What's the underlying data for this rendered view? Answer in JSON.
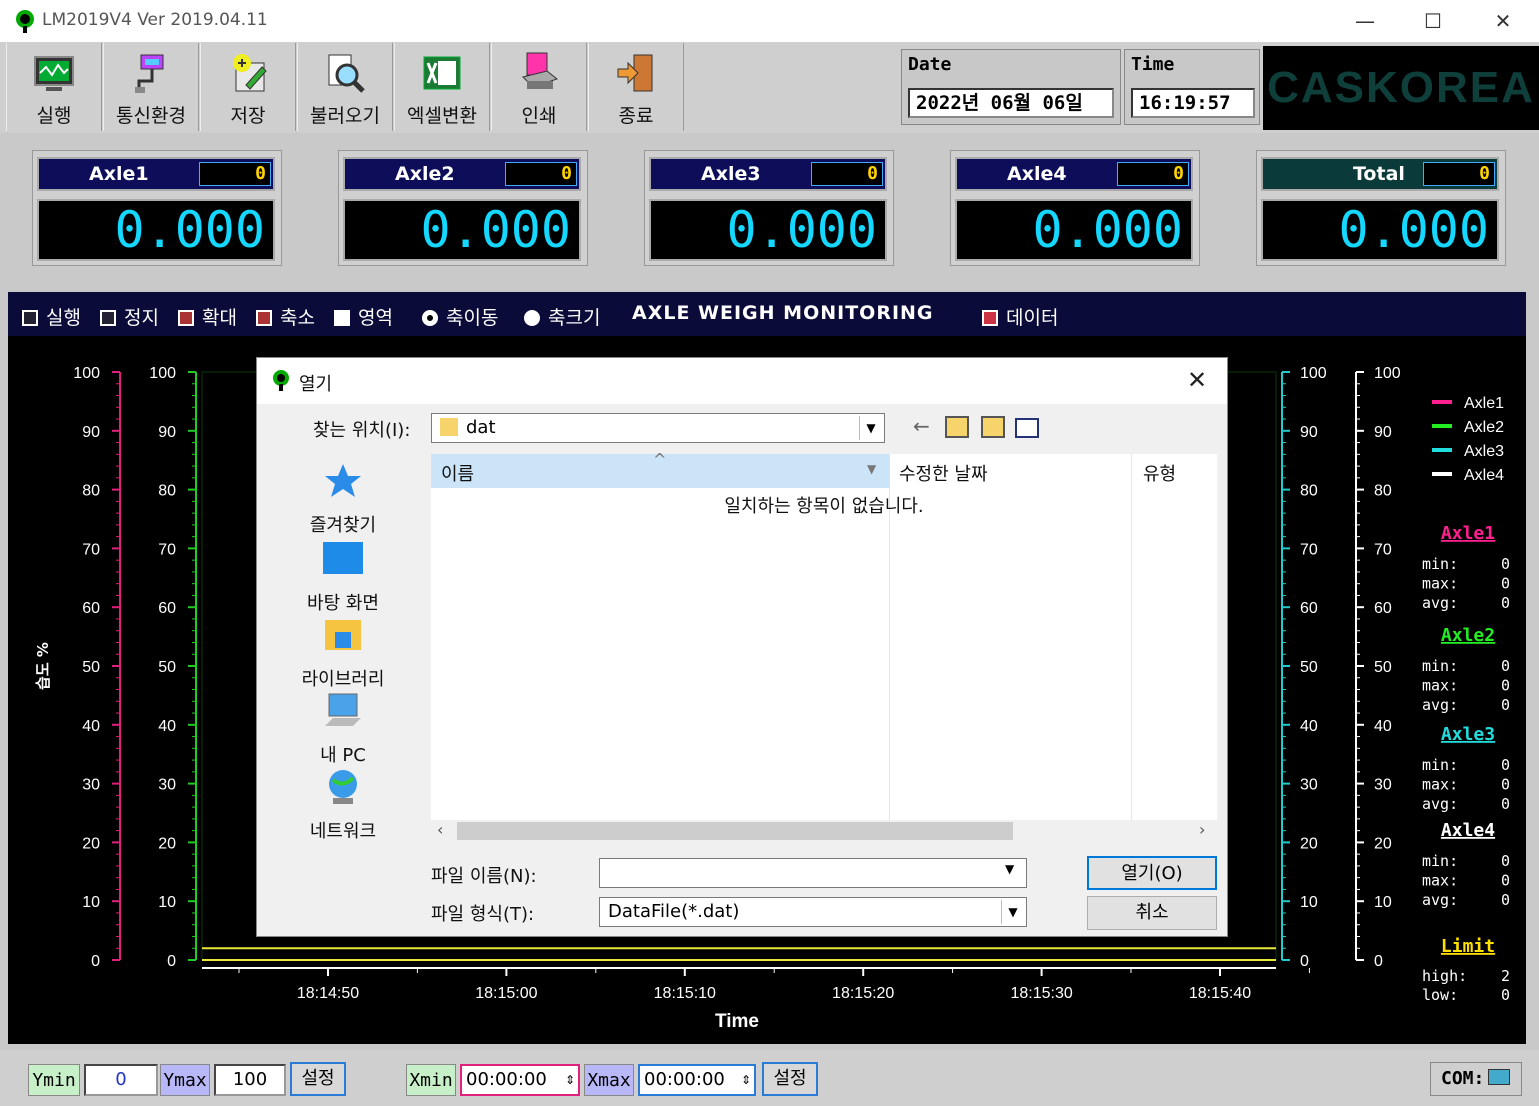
{
  "window": {
    "title": "LM2019V4   Ver 2019.04.11",
    "minimize": "—",
    "maximize": "☐",
    "close": "✕"
  },
  "toolbar": {
    "buttons": [
      {
        "label": "실행"
      },
      {
        "label": "통신환경"
      },
      {
        "label": "저장"
      },
      {
        "label": "불러오기"
      },
      {
        "label": "엑셀변환"
      },
      {
        "label": "인쇄"
      },
      {
        "label": "종료"
      }
    ],
    "date_label": "Date",
    "date_value": "2022년  06월  06일",
    "time_label": "Time",
    "time_value": "16:19:57",
    "brand": "CASKOREA"
  },
  "axles": [
    {
      "name": "Axle1",
      "count": "0",
      "value": "0.000"
    },
    {
      "name": "Axle2",
      "count": "0",
      "value": "0.000"
    },
    {
      "name": "Axle3",
      "count": "0",
      "value": "0.000"
    },
    {
      "name": "Axle4",
      "count": "0",
      "value": "0.000"
    },
    {
      "name": "Total",
      "count": "0",
      "value": "0.000"
    }
  ],
  "chartbar": {
    "run": "실행",
    "stop": "정지",
    "zoom_in": "확대",
    "zoom_out": "축소",
    "area": "영역",
    "axis_move": "축이동",
    "axis_size": "축크기",
    "title": "AXLE WEIGH MONITORING",
    "data": "데이터"
  },
  "chart_data": {
    "type": "line",
    "title": "",
    "xlabel": "Time",
    "ylabel": "습도 %",
    "ylim": [
      0,
      100
    ],
    "y_ticks": [
      "0",
      "10",
      "20",
      "30",
      "40",
      "50",
      "60",
      "70",
      "80",
      "90",
      "100"
    ],
    "x_ticks": [
      "18:14:50",
      "18:15:00",
      "18:15:10",
      "18:15:20",
      "18:15:30",
      "18:15:40"
    ],
    "legend": [
      {
        "name": "Axle1",
        "color": "#ff1f8f"
      },
      {
        "name": "Axle2",
        "color": "#22ee22"
      },
      {
        "name": "Axle3",
        "color": "#22dddd"
      },
      {
        "name": "Axle4",
        "color": "#ffffff"
      }
    ],
    "limit_lines": [
      0,
      2
    ],
    "series": []
  },
  "stats": [
    {
      "name": "Axle1",
      "color": "#ff1f8f",
      "min": "0",
      "max": "0",
      "avg": "0"
    },
    {
      "name": "Axle2",
      "color": "#22ee22",
      "min": "0",
      "max": "0",
      "avg": "0"
    },
    {
      "name": "Axle3",
      "color": "#22dddd",
      "min": "0",
      "max": "0",
      "avg": "0"
    },
    {
      "name": "Axle4",
      "color": "#ffffff",
      "min": "0",
      "max": "0",
      "avg": "0"
    }
  ],
  "stat_labels": {
    "min": "min:",
    "max": "max:",
    "avg": "avg:"
  },
  "limit": {
    "title": "Limit",
    "high_label": "high:",
    "high": "2",
    "low_label": "low:",
    "low": "0"
  },
  "bottombar": {
    "ymin_label": "Ymin",
    "ymin_value": "0",
    "ymax_label": "Ymax",
    "ymax_value": "100",
    "set_label": "설정",
    "xmin_label": "Xmin",
    "xmin_value": "00:00:00",
    "xmax_label": "Xmax",
    "xmax_value": "00:00:00",
    "com_label": "COM:"
  },
  "dialog": {
    "title": "열기",
    "look_in_label": "찾는 위치(I):",
    "look_in_value": "dat",
    "places": [
      "즐겨찾기",
      "바탕 화면",
      "라이브러리",
      "내 PC",
      "네트워크"
    ],
    "columns": [
      "이름",
      "수정한 날짜",
      "유형"
    ],
    "empty_message": "일치하는 항목이 없습니다.",
    "filename_label": "파일 이름(N):",
    "filename_value": "",
    "filetype_label": "파일 형식(T):",
    "filetype_value": "DataFile(*.dat)",
    "open_button": "열기(O)",
    "cancel_button": "취소"
  }
}
